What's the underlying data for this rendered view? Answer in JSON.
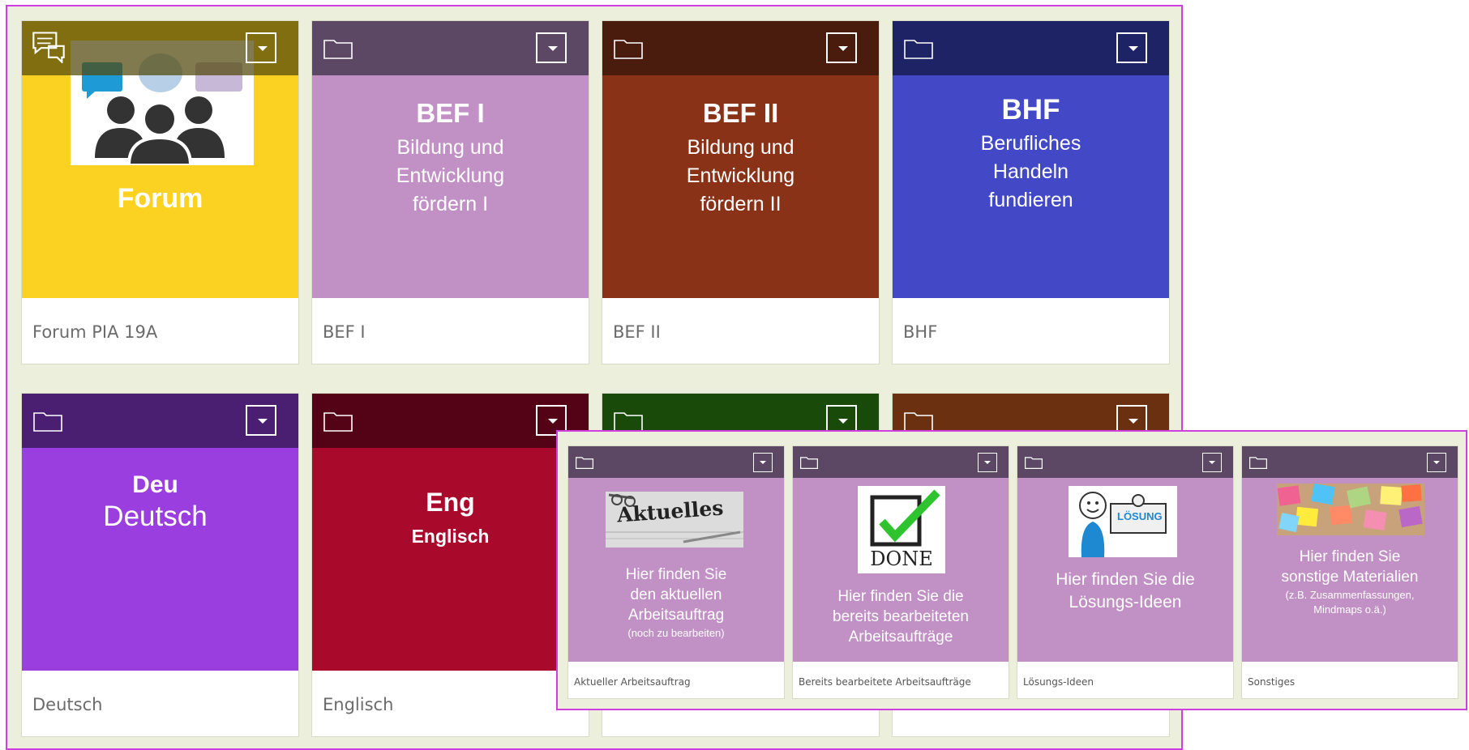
{
  "tiles": [
    {
      "footer": "Forum PIA 19A",
      "title": "Forum",
      "color": "#fbd222",
      "topbar": "#7a6a12"
    },
    {
      "footer": "BEF I",
      "title": "BEF I",
      "lines": [
        "Bildung und",
        "Entwicklung",
        "fördern I"
      ],
      "color": "#c190c4",
      "topbar": "#5c4865"
    },
    {
      "footer": "BEF II",
      "title": "BEF II",
      "lines": [
        "Bildung und",
        "Entwicklung",
        "fördern II"
      ],
      "color": "#8a3218",
      "topbar": "#4a1c0e"
    },
    {
      "footer": "BHF",
      "title": "BHF",
      "lines": [
        "Berufliches",
        "Handeln",
        "fundieren"
      ],
      "color": "#4349c6",
      "topbar": "#1e2366"
    },
    {
      "footer": "Deutsch",
      "title": "Deu",
      "subtitle": "Deutsch",
      "color": "#9b3ee0",
      "topbar": "#4a1f72"
    },
    {
      "footer": "Englisch",
      "title": "Eng",
      "subtitle": "Englisch",
      "color": "#a90a2b",
      "topbar": "#540316"
    },
    {
      "color": "#2e8a18",
      "topbar": "#1a4a0a"
    },
    {
      "color": "#b05a10",
      "topbar": "#6a3010"
    }
  ],
  "subtiles": [
    {
      "footer": "Aktueller Arbeitsauftrag",
      "image_text": "Aktuelles",
      "lines": [
        "Hier finden Sie",
        "den aktuellen",
        "Arbeitsauftrag"
      ],
      "small": "(noch zu bearbeiten)"
    },
    {
      "footer": "Bereits bearbeitete Arbeitsaufträge",
      "image_text": "DONE",
      "lines": [
        "Hier finden Sie die",
        "bereits bearbeiteten",
        "Arbeitsaufträge"
      ]
    },
    {
      "footer": "Lösungs-Ideen",
      "image_text": "LÖSUNG",
      "lines": [
        "Hier finden Sie die",
        "Lösungs-Ideen"
      ]
    },
    {
      "footer": "Sonstiges",
      "lines": [
        "Hier finden Sie",
        "sonstige Materialien"
      ],
      "small": "(z.B. Zusammenfassungen,",
      "small2": "Mindmaps o.ä.)"
    }
  ],
  "icons": {
    "folder": "folder-icon",
    "menu": "chevron-down-icon",
    "forum": "chat-bubbles-icon"
  }
}
